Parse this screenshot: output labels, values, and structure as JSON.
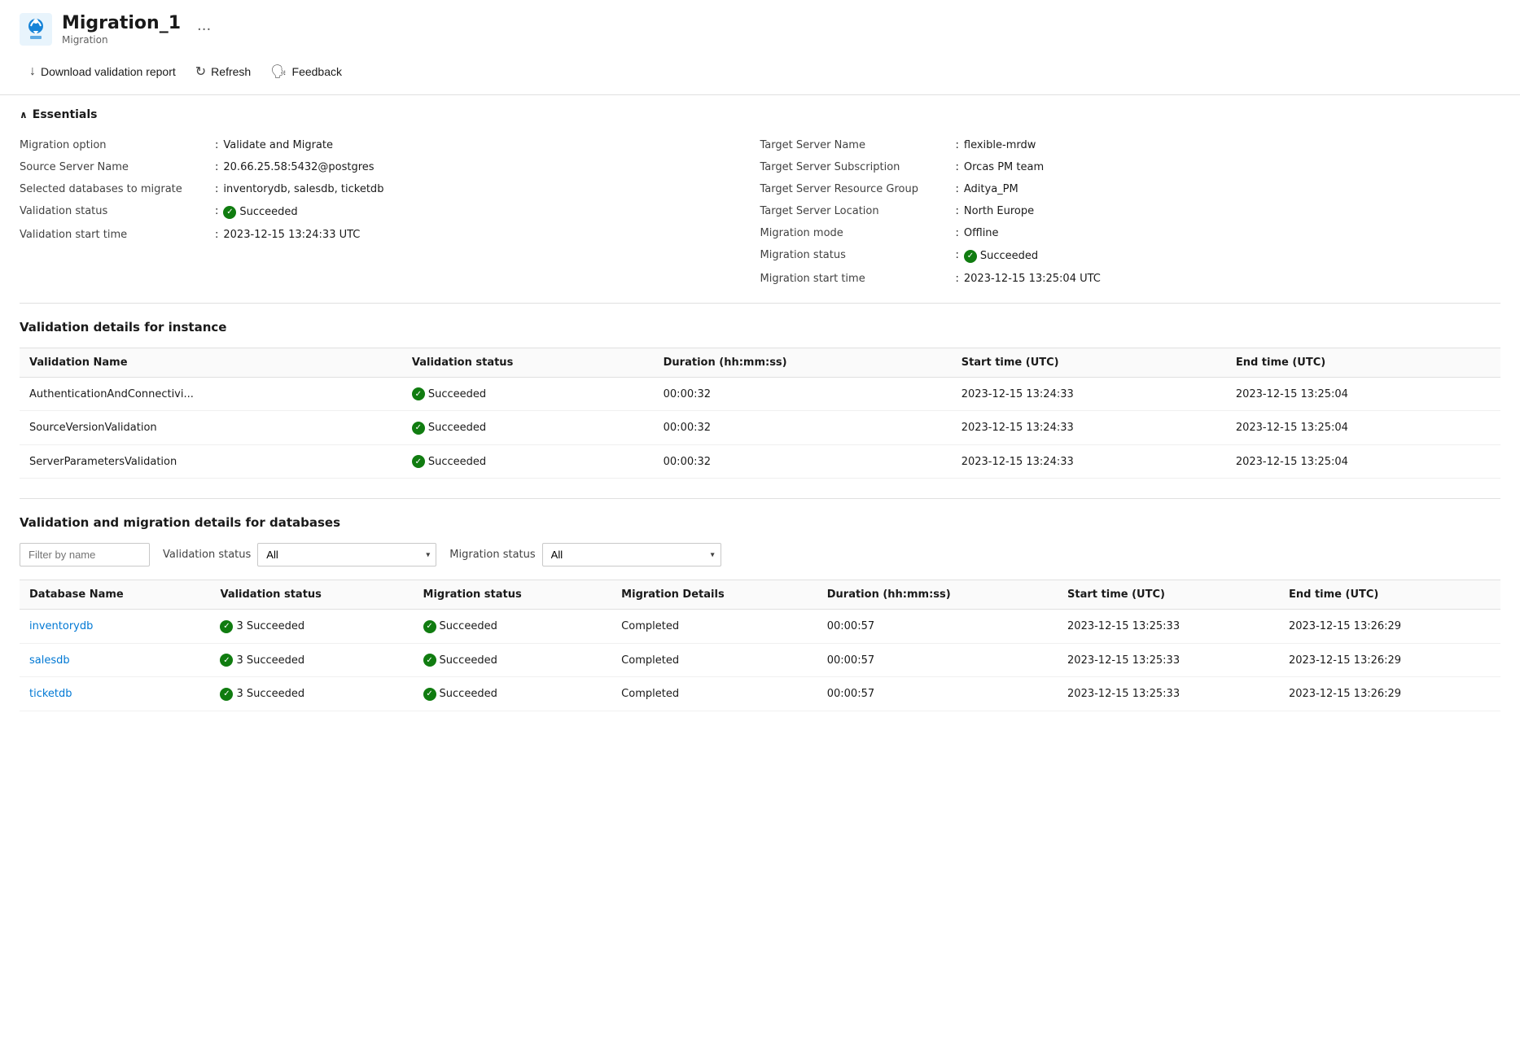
{
  "header": {
    "title": "Migration_1",
    "subtitle": "Migration",
    "more_label": "···"
  },
  "toolbar": {
    "download_label": "Download validation report",
    "refresh_label": "Refresh",
    "feedback_label": "Feedback"
  },
  "essentials": {
    "section_label": "Essentials",
    "left": [
      {
        "label": "Migration option",
        "value": "Validate and Migrate"
      },
      {
        "label": "Source Server Name",
        "value": "20.66.25.58:5432@postgres"
      },
      {
        "label": "Selected databases to migrate",
        "value": "inventorydb, salesdb, ticketdb"
      },
      {
        "label": "Validation status",
        "value": "Succeeded",
        "is_status": true
      },
      {
        "label": "Validation start time",
        "value": "2023-12-15 13:24:33 UTC"
      }
    ],
    "right": [
      {
        "label": "Target Server Name",
        "value": "flexible-mrdw"
      },
      {
        "label": "Target Server Subscription",
        "value": "Orcas PM team"
      },
      {
        "label": "Target Server Resource Group",
        "value": "Aditya_PM"
      },
      {
        "label": "Target Server Location",
        "value": "North Europe"
      },
      {
        "label": "Migration mode",
        "value": "Offline"
      },
      {
        "label": "Migration status",
        "value": "Succeeded",
        "is_status": true
      },
      {
        "label": "Migration start time",
        "value": "2023-12-15 13:25:04 UTC"
      }
    ]
  },
  "validation_details": {
    "section_title": "Validation details for instance",
    "columns": [
      "Validation Name",
      "Validation status",
      "Duration (hh:mm:ss)",
      "Start time (UTC)",
      "End time (UTC)"
    ],
    "rows": [
      {
        "name": "AuthenticationAndConnectivi...",
        "status": "Succeeded",
        "duration": "00:00:32",
        "start_time": "2023-12-15 13:24:33",
        "end_time": "2023-12-15 13:25:04"
      },
      {
        "name": "SourceVersionValidation",
        "status": "Succeeded",
        "duration": "00:00:32",
        "start_time": "2023-12-15 13:24:33",
        "end_time": "2023-12-15 13:25:04"
      },
      {
        "name": "ServerParametersValidation",
        "status": "Succeeded",
        "duration": "00:00:32",
        "start_time": "2023-12-15 13:24:33",
        "end_time": "2023-12-15 13:25:04"
      }
    ]
  },
  "database_details": {
    "section_title": "Validation and migration details for databases",
    "filter_placeholder": "Filter by name",
    "validation_status_label": "Validation status",
    "migration_status_label": "Migration status",
    "filter_all_option": "All",
    "columns": [
      "Database Name",
      "Validation status",
      "Migration status",
      "Migration Details",
      "Duration (hh:mm:ss)",
      "Start time (UTC)",
      "End time (UTC)"
    ],
    "rows": [
      {
        "name": "inventorydb",
        "validation_status": "3 Succeeded",
        "migration_status": "Succeeded",
        "migration_details": "Completed",
        "duration": "00:00:57",
        "start_time": "2023-12-15 13:25:33",
        "end_time": "2023-12-15 13:26:29"
      },
      {
        "name": "salesdb",
        "validation_status": "3 Succeeded",
        "migration_status": "Succeeded",
        "migration_details": "Completed",
        "duration": "00:00:57",
        "start_time": "2023-12-15 13:25:33",
        "end_time": "2023-12-15 13:26:29"
      },
      {
        "name": "ticketdb",
        "validation_status": "3 Succeeded",
        "migration_status": "Succeeded",
        "migration_details": "Completed",
        "duration": "00:00:57",
        "start_time": "2023-12-15 13:25:33",
        "end_time": "2023-12-15 13:26:29"
      }
    ]
  }
}
